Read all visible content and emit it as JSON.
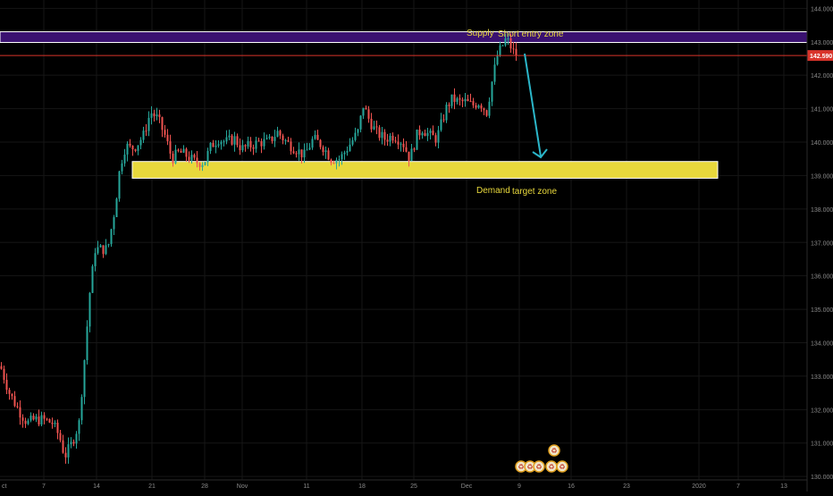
{
  "chart_data": {
    "type": "candlestick",
    "price_axis": {
      "ticks": [
        "144.000",
        "143.000",
        "142.000",
        "141.000",
        "140.000",
        "139.000",
        "138.000",
        "137.000",
        "136.000",
        "135.000",
        "134.000",
        "133.000",
        "132.000",
        "131.000",
        "130.000"
      ],
      "range": [
        129.55,
        144.25
      ]
    },
    "time_axis": {
      "ticks": [
        "ct",
        "7",
        "14",
        "21",
        "28",
        "Nov",
        "11",
        "18",
        "25",
        "Dec",
        "9",
        "16",
        "23",
        "2020",
        "7",
        "13"
      ]
    },
    "last_price": {
      "label": "142.590",
      "value": 142.59
    },
    "zones": [
      {
        "name": "supply",
        "price_low": 142.98,
        "price_high": 143.3,
        "color": "#3a1170",
        "border": "#ffffff"
      },
      {
        "name": "demand",
        "price_low": 138.92,
        "price_high": 139.42,
        "color": "#e8d83c",
        "border": "#ffffff"
      }
    ],
    "annotations": {
      "supply": "Supply",
      "short_entry": "Short entry zone",
      "demand": "Demand",
      "target": "target zone"
    },
    "colors": {
      "bull": "#26a69a",
      "bear": "#ef5350",
      "arrow": "#2bb6c9",
      "label_text": "#e8d83c",
      "grid": "#161616",
      "axis_text": "#8a8a8a",
      "price_line": "#d9342b"
    },
    "trend_path": [
      [
        0,
        133.3
      ],
      [
        10,
        132.5
      ],
      [
        20,
        132.0
      ],
      [
        30,
        131.6
      ],
      [
        38,
        131.7
      ],
      [
        48,
        131.7
      ],
      [
        58,
        131.6
      ],
      [
        66,
        131.2
      ],
      [
        72,
        130.6
      ],
      [
        80,
        131.0
      ],
      [
        88,
        131.6
      ],
      [
        94,
        133.5
      ],
      [
        100,
        135.5
      ],
      [
        106,
        136.8
      ],
      [
        112,
        136.8
      ],
      [
        120,
        136.8
      ],
      [
        128,
        138.0
      ],
      [
        134,
        139.3
      ],
      [
        140,
        139.9
      ],
      [
        146,
        139.8
      ],
      [
        152,
        139.9
      ],
      [
        160,
        140.2
      ],
      [
        168,
        140.9
      ],
      [
        176,
        140.7
      ],
      [
        184,
        140.2
      ],
      [
        192,
        139.5
      ],
      [
        200,
        139.7
      ],
      [
        208,
        139.6
      ],
      [
        218,
        139.4
      ],
      [
        228,
        139.4
      ],
      [
        236,
        139.9
      ],
      [
        244,
        140.1
      ],
      [
        252,
        140.0
      ],
      [
        262,
        140.1
      ],
      [
        270,
        139.8
      ],
      [
        280,
        139.9
      ],
      [
        290,
        140.0
      ],
      [
        300,
        140.0
      ],
      [
        310,
        140.3
      ],
      [
        320,
        140.0
      ],
      [
        330,
        139.8
      ],
      [
        340,
        139.6
      ],
      [
        350,
        140.1
      ],
      [
        360,
        139.9
      ],
      [
        370,
        139.5
      ],
      [
        380,
        139.5
      ],
      [
        390,
        139.9
      ],
      [
        400,
        140.3
      ],
      [
        406,
        141.1
      ],
      [
        412,
        140.7
      ],
      [
        420,
        140.3
      ],
      [
        430,
        140.1
      ],
      [
        440,
        140.2
      ],
      [
        450,
        140.0
      ],
      [
        458,
        139.5
      ],
      [
        466,
        140.2
      ],
      [
        472,
        140.4
      ],
      [
        480,
        140.2
      ],
      [
        488,
        140.1
      ],
      [
        494,
        140.6
      ],
      [
        500,
        141.1
      ],
      [
        506,
        141.3
      ],
      [
        512,
        141.2
      ],
      [
        520,
        141.2
      ],
      [
        528,
        141.1
      ],
      [
        536,
        141.2
      ],
      [
        544,
        140.9
      ],
      [
        550,
        141.8
      ],
      [
        556,
        142.6
      ],
      [
        562,
        142.9
      ],
      [
        566,
        143.1
      ],
      [
        570,
        142.9
      ],
      [
        574,
        142.7
      ],
      [
        578,
        142.6
      ]
    ],
    "grid": true,
    "emoji_marks": [
      "♻",
      "♻",
      "♻",
      "♻",
      "♻",
      "♻"
    ]
  }
}
